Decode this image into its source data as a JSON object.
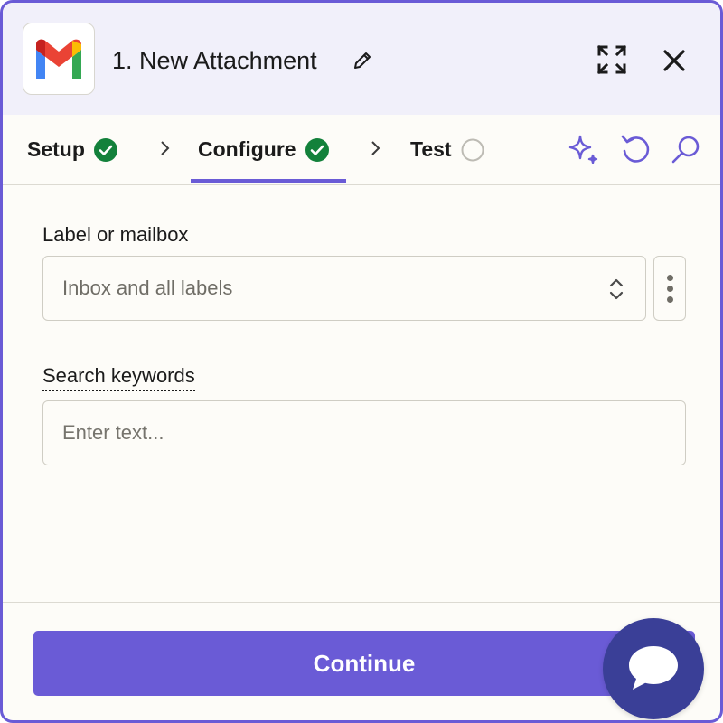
{
  "header": {
    "title": "1. New Attachment",
    "app_icon": "gmail-logo",
    "icons": [
      "pencil-icon",
      "expand-icon",
      "close-icon"
    ]
  },
  "tabs": [
    {
      "label": "Setup",
      "status": "complete"
    },
    {
      "label": "Configure",
      "status": "complete",
      "active": true
    },
    {
      "label": "Test",
      "status": "incomplete"
    }
  ],
  "toolbar_icons": [
    "sparkle-icon",
    "undo-icon",
    "search-icon"
  ],
  "form": {
    "mailbox": {
      "label": "Label or mailbox",
      "value": "Inbox and all labels"
    },
    "keywords": {
      "label": "Search keywords",
      "placeholder": "Enter text..."
    }
  },
  "footer": {
    "continue_label": "Continue"
  },
  "colors": {
    "accent": "#6a5bd6",
    "success": "#13813b",
    "chat_bubble": "#3a3f97",
    "header_bg": "#f1f0fa"
  }
}
